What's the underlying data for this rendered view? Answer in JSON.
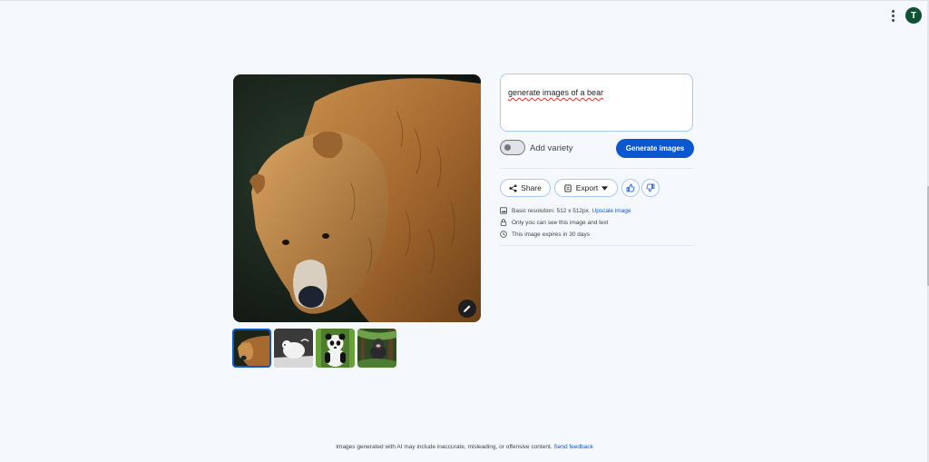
{
  "header": {
    "avatar_initial": "T"
  },
  "prompt": {
    "text": "generate images of a bear"
  },
  "controls": {
    "variety_label": "Add variety",
    "generate_label": "Generate images"
  },
  "actions": {
    "share_label": "Share",
    "export_label": "Export"
  },
  "info": {
    "resolution_text": "Basic resolution: 512 x 512px.",
    "upscale_link": "Upscale image",
    "privacy_text": "Only you can see this image and text",
    "expiry_text": "This image expires in 30 days"
  },
  "thumbnails": [
    {
      "label": "brown-bear"
    },
    {
      "label": "polar-bear-sketch"
    },
    {
      "label": "panda"
    },
    {
      "label": "bear-in-forest"
    }
  ],
  "footer": {
    "disclaimer": "Images generated with AI may include inaccurate, misleading, or offensive content.",
    "feedback_link": "Send feedback"
  },
  "colors": {
    "accent": "#0b57d0",
    "background": "#f5f8fd",
    "border": "#a8c7fa"
  }
}
